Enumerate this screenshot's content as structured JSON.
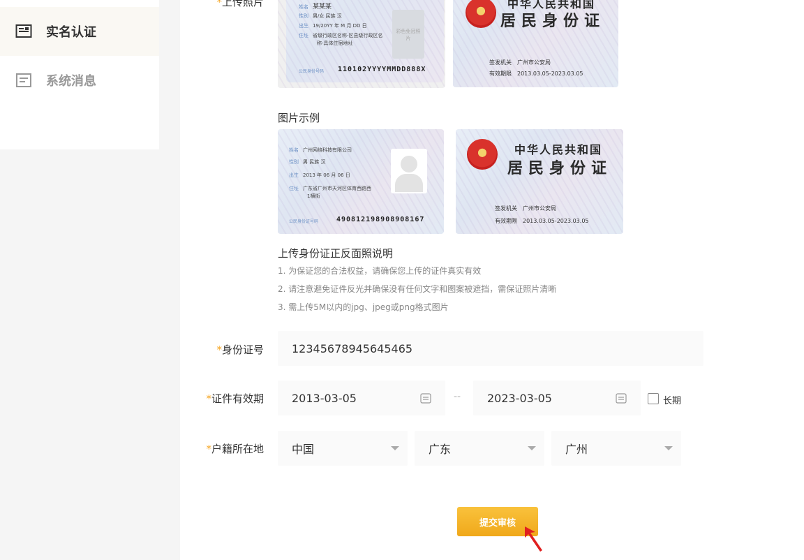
{
  "sidebar": {
    "items": [
      {
        "label": "实名认证",
        "icon": "id-card-icon",
        "active": true
      },
      {
        "label": "系统消息",
        "icon": "message-icon",
        "active": false
      }
    ]
  },
  "upload": {
    "label": "上传照片",
    "front_card": {
      "rows": [
        {
          "k": "姓名",
          "v": "某某某"
        },
        {
          "k": "性别",
          "v": "男/女    民族  汉"
        },
        {
          "k": "出生",
          "v": "19/20YY  年  M  月  DD  日"
        },
        {
          "k": "住址",
          "v": "省级行政区名称-区县级行政区名"
        }
      ],
      "address_line2": "称-具体住宿地址",
      "photo_text": "彩色免冠照片",
      "number_key": "公民身份号码",
      "number": "110102YYYYMMDD888X"
    },
    "back_card": {
      "title1": "中华人民共和国",
      "title2": "居民身份证",
      "issuer_key": "签发机关",
      "issuer": "广州市公安局",
      "valid_key": "有效期限",
      "valid": "2013.03.05-2023.03.05"
    }
  },
  "example": {
    "title": "图片示例",
    "front_card": {
      "rows": [
        {
          "k": "姓名",
          "v": "广州网络科技有限公司"
        },
        {
          "k": "性别",
          "v": "男    民族  汉"
        },
        {
          "k": "出生",
          "v": "2013  年  06  月  06  日"
        },
        {
          "k": "住址",
          "v": "广东省广州市天河区体育西路西"
        }
      ],
      "address_line2": "1横街",
      "number_key": "公民身份证号码",
      "number": "490812198908908167"
    },
    "back_card": {
      "title1": "中华人民共和国",
      "title2": "居民身份证",
      "issuer_key": "签发机关",
      "issuer": "广州市公安局",
      "valid_key": "有效期限",
      "valid": "2013.03.05-2023.03.05"
    }
  },
  "instructions": {
    "title": "上传身份证正反面照说明",
    "lines": [
      "1. 为保证您的合法权益，请确保您上传的证件真实有效",
      "2. 请注意避免证件反光并确保没有任何文字和图案被遮挡，需保证照片清晰",
      "3. 需上传5M以内的jpg、jpeg或png格式图片"
    ]
  },
  "form": {
    "required_mark": "*",
    "id_number": {
      "label": "身份证号",
      "value": "12345678945645465"
    },
    "validity": {
      "label": "证件有效期",
      "start": "2013-03-05",
      "separator": "--",
      "end": "2023-03-05",
      "long_term_label": "长期",
      "long_term_checked": false
    },
    "residence": {
      "label": "户籍所在地",
      "country": "中国",
      "province": "广东",
      "city": "广州"
    }
  },
  "submit_label": "提交审核",
  "colors": {
    "accent": "#f5a623",
    "cursor": "#e02020"
  }
}
